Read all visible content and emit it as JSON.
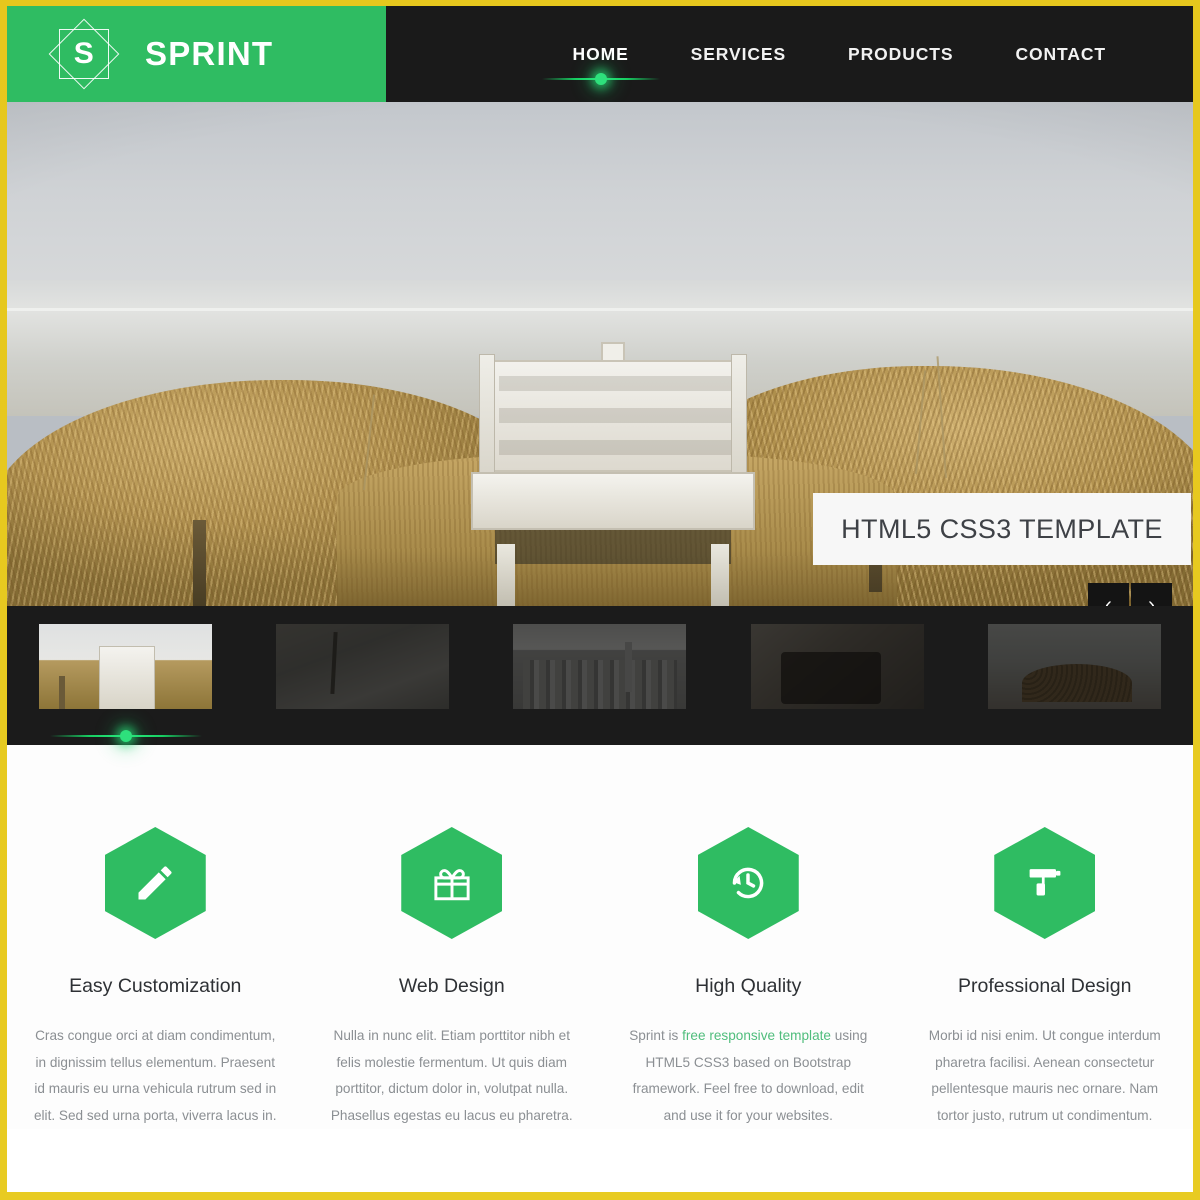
{
  "brand": {
    "name": "SPRINT",
    "mark_letter": "S",
    "green": "#2fbc62",
    "dark": "#1a1a1a",
    "frame": "#e6c71d"
  },
  "nav": {
    "items": [
      {
        "label": "HOME",
        "active": true
      },
      {
        "label": "SERVICES",
        "active": false
      },
      {
        "label": "PRODUCTS",
        "active": false
      },
      {
        "label": "CONTACT",
        "active": false
      }
    ]
  },
  "hero": {
    "caption": "HTML5 CSS3 TEMPLATE",
    "prev_label": "‹",
    "next_label": "›"
  },
  "thumbnails": [
    {
      "name": "beach-bench",
      "active": true
    },
    {
      "name": "foggy-forest",
      "active": false
    },
    {
      "name": "city-skyline",
      "active": false
    },
    {
      "name": "bicycle-street",
      "active": false
    },
    {
      "name": "log-pile",
      "active": false
    }
  ],
  "features": [
    {
      "icon": "pencil-icon",
      "title": "Easy Customization",
      "text": "Cras congue orci at diam condimentum, in dignissim tellus elementum. Praesent id mauris eu urna vehicula rutrum sed in elit. Sed sed urna porta, viverra lacus in."
    },
    {
      "icon": "gift-icon",
      "title": "Web Design",
      "text": "Nulla in nunc elit. Etiam porttitor nibh et felis molestie fermentum. Ut quis diam porttitor, dictum dolor in, volutpat nulla. Phasellus egestas eu lacus eu pharetra."
    },
    {
      "icon": "history-clock-icon",
      "title": "High Quality",
      "text_before": "Sprint is ",
      "link_text": "free responsive template",
      "text_after": " using HTML5 CSS3 based on Bootstrap framework. Feel free to download, edit and use it for your websites.",
      "link_color": "#4fbd7c"
    },
    {
      "icon": "paint-roller-icon",
      "title": "Professional Design",
      "text": "Morbi id nisi enim. Ut congue interdum pharetra facilisi. Aenean consectetur pellentesque mauris nec ornare. Nam tortor justo, rutrum ut condimentum."
    }
  ]
}
